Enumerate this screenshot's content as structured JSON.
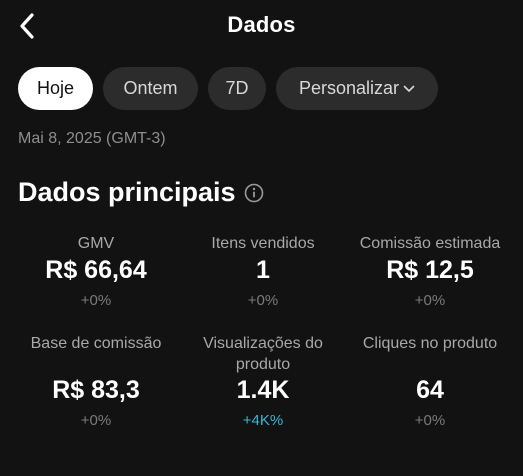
{
  "header": {
    "title": "Dados",
    "back_icon": "chevron-left-icon"
  },
  "filters": {
    "today": "Hoje",
    "yesterday": "Ontem",
    "last7": "7D",
    "custom": "Personalizar",
    "selected": "Hoje"
  },
  "date_label": "Mai 8, 2025 (GMT-3)",
  "section": {
    "title": "Dados principais",
    "info_icon": "info-icon"
  },
  "metrics": [
    {
      "label": "GMV",
      "value": "R$ 66,64",
      "delta": "+0%"
    },
    {
      "label": "Itens vendidos",
      "value": "1",
      "delta": "+0%"
    },
    {
      "label": "Comissão estimada",
      "value": "R$ 12,5",
      "delta": "+0%"
    },
    {
      "label": "Base de comissão",
      "value": "R$ 83,3",
      "delta": "+0%"
    },
    {
      "label": "Visualizações do produto",
      "value": "1.4K",
      "delta": "+4K%"
    },
    {
      "label": "Cliques no produto",
      "value": "64",
      "delta": "+0%"
    }
  ],
  "colors": {
    "background": "#121212",
    "chip": "#2c2c2c",
    "chip_active": "#ffffff",
    "positive_delta": "#35b7d6",
    "neutral_delta": "#7a7a7a"
  }
}
